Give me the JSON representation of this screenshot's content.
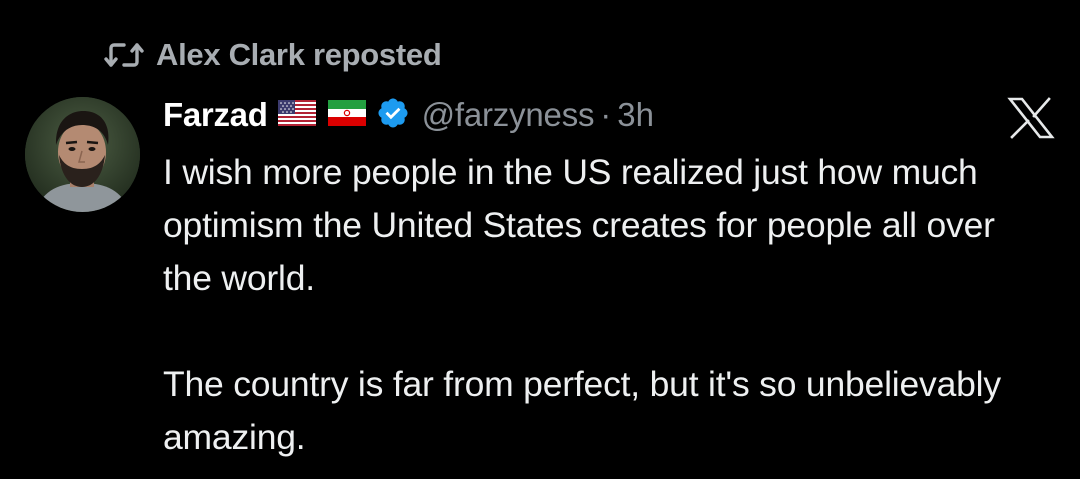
{
  "repost": {
    "text": "Alex Clark reposted",
    "icon": "repost-icon"
  },
  "author": {
    "display_name": "Farzad",
    "flags": [
      "us-flag-icon",
      "iran-flag-icon"
    ],
    "verified_icon": "verified-badge-icon",
    "handle": "@farzyness",
    "separator": "·",
    "time": "3h"
  },
  "brand": {
    "logo": "x-logo-icon"
  },
  "tweet": {
    "paragraph1": "I wish more people in the US realized just how much optimism the United States creates for people all over the world.",
    "paragraph2": "The country is far from perfect, but it's so unbelievably amazing."
  },
  "colors": {
    "background": "#000000",
    "primary_text": "#e7e9ea",
    "secondary_text": "#8b9198",
    "verified": "#1d9bf0"
  }
}
